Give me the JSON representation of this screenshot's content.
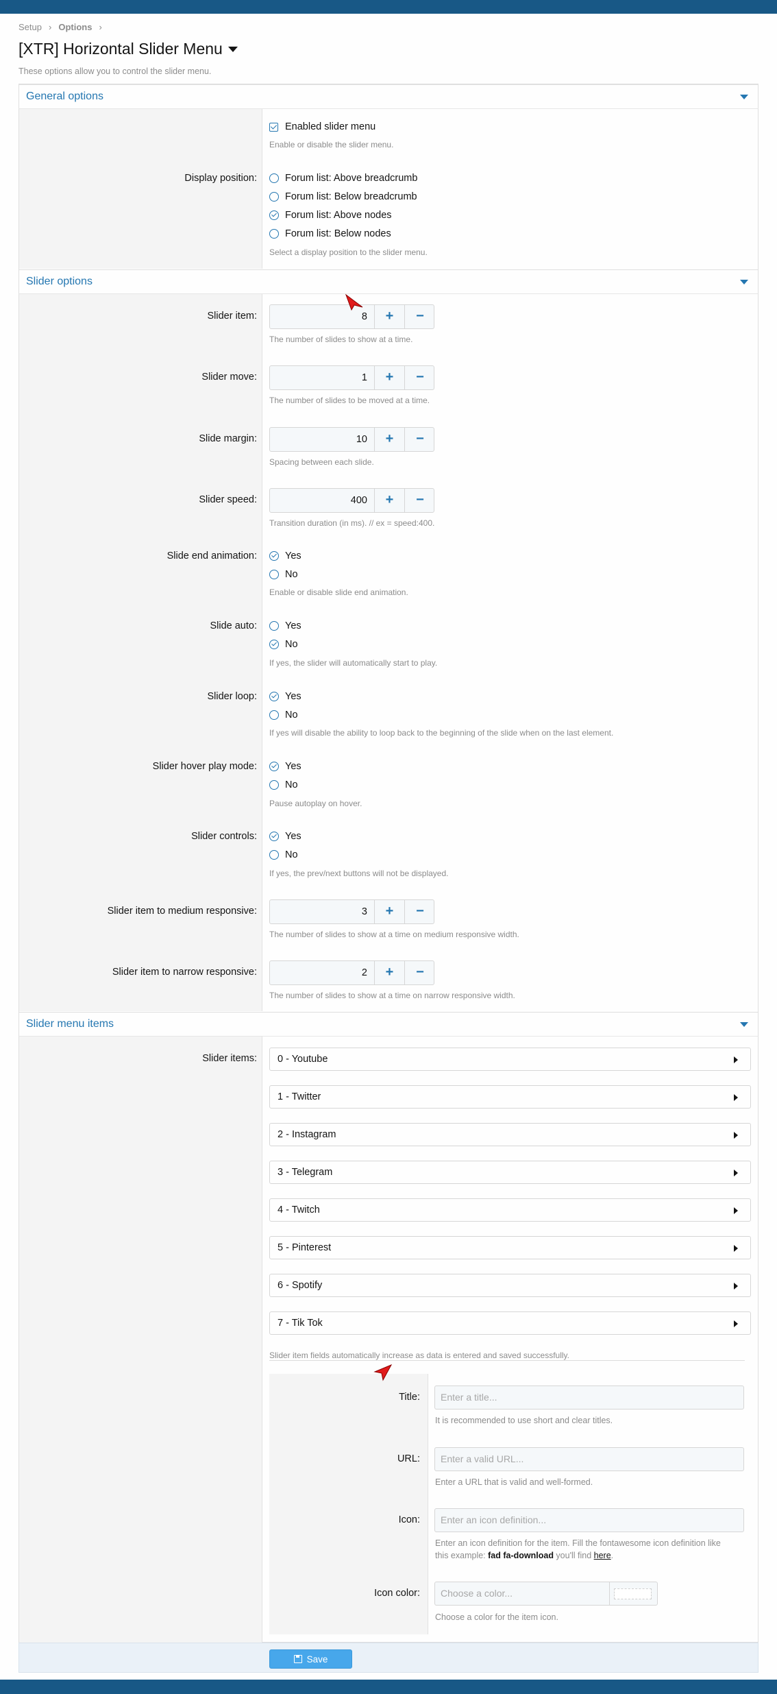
{
  "breadcrumb": {
    "items": [
      "Setup",
      "Options"
    ]
  },
  "page": {
    "title": "[XTR] Horizontal Slider Menu",
    "description": "These options allow you to control the slider menu."
  },
  "general": {
    "header": "General options",
    "enabled_label": "Enabled slider menu",
    "enabled_hint": "Enable or disable the slider menu.",
    "display_position_label": "Display position:",
    "positions": [
      "Forum list: Above breadcrumb",
      "Forum list: Below breadcrumb",
      "Forum list: Above nodes",
      "Forum list: Below nodes"
    ],
    "selected_position": "Forum list: Above nodes",
    "position_hint": "Select a display position to the slider menu."
  },
  "slider": {
    "header": "Slider options",
    "item": {
      "label": "Slider item:",
      "value": "8",
      "hint": "The number of slides to show at a time."
    },
    "move": {
      "label": "Slider move:",
      "value": "1",
      "hint": "The number of slides to be moved at a time."
    },
    "margin": {
      "label": "Slide margin:",
      "value": "10",
      "hint": "Spacing between each slide."
    },
    "speed": {
      "label": "Slider speed:",
      "value": "400",
      "hint": "Transition duration (in ms). // ex = speed:400."
    },
    "end_animation": {
      "label": "Slide end animation:",
      "yes": "Yes",
      "no": "No",
      "selected": "Yes",
      "hint": "Enable or disable slide end animation."
    },
    "auto": {
      "label": "Slide auto:",
      "yes": "Yes",
      "no": "No",
      "selected": "No",
      "hint": "If yes, the slider will automatically start to play."
    },
    "loop": {
      "label": "Slider loop:",
      "yes": "Yes",
      "no": "No",
      "selected": "Yes",
      "hint": "If yes will disable the ability to loop back to the beginning of the slide when on the last element."
    },
    "hover": {
      "label": "Slider hover play mode:",
      "yes": "Yes",
      "no": "No",
      "selected": "Yes",
      "hint": "Pause autoplay on hover."
    },
    "controls": {
      "label": "Slider controls:",
      "yes": "Yes",
      "no": "No",
      "selected": "Yes",
      "hint": "If yes, the prev/next buttons will not be displayed."
    },
    "medium": {
      "label": "Slider item to medium responsive:",
      "value": "3",
      "hint": "The number of slides to show at a time on medium responsive width."
    },
    "narrow": {
      "label": "Slider item to narrow responsive:",
      "value": "2",
      "hint": "The number of slides to show at a time on narrow responsive width."
    },
    "plus": "+",
    "minus": "−"
  },
  "menu_items": {
    "header": "Slider menu items",
    "label": "Slider items:",
    "items": [
      "0 - Youtube",
      "1 - Twitter",
      "2 - Instagram",
      "3 - Telegram",
      "4 - Twitch",
      "5 - Pinterest",
      "6 - Spotify",
      "7 - Tik Tok"
    ],
    "hint": "Slider item fields automatically increase as data is entered and saved successfully.",
    "title_label": "Title:",
    "title_placeholder": "Enter a title...",
    "title_hint": "It is recommended to use short and clear titles.",
    "url_label": "URL:",
    "url_placeholder": "Enter a valid URL...",
    "url_hint": "Enter a URL that is valid and well-formed.",
    "icon_label": "Icon:",
    "icon_placeholder": "Enter an icon definition...",
    "icon_hint_1": "Enter an icon definition for the item. Fill the fontawesome icon definition like",
    "icon_hint_2a": "this example: ",
    "icon_hint_example": "fad fa-download",
    "icon_hint_2b": " you'll find ",
    "icon_hint_link": "here",
    "icon_hint_2c": ".",
    "color_label": "Icon color:",
    "color_placeholder": "Choose a color...",
    "color_hint": "Choose a color for the item icon."
  },
  "save_label": "Save",
  "colors": {
    "accent": "#2577b1",
    "topbar": "#185886",
    "button": "#47a7eb",
    "label_bg": "#f4f4f4"
  }
}
